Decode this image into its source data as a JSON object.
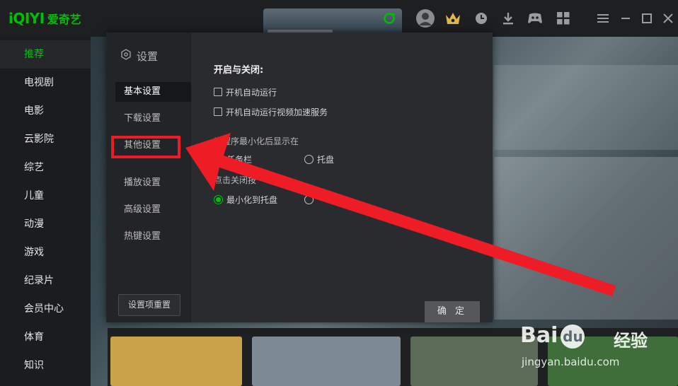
{
  "app": {
    "logo_mark": "iQIYI",
    "logo_cn": "爱奇艺"
  },
  "topbar": {
    "icons": [
      "vip-crown-icon",
      "history-icon",
      "download-icon",
      "game-controller-icon",
      "apps-grid-icon",
      "menu-icon",
      "minimize-icon",
      "maximize-icon",
      "close-icon"
    ],
    "accent": "#00be06"
  },
  "nav": {
    "items": [
      {
        "label": "推荐"
      },
      {
        "label": "电视剧"
      },
      {
        "label": "电影"
      },
      {
        "label": "云影院"
      },
      {
        "label": "综艺"
      },
      {
        "label": "儿童"
      },
      {
        "label": "动漫"
      },
      {
        "label": "游戏"
      },
      {
        "label": "纪录片"
      },
      {
        "label": "会员中心"
      },
      {
        "label": "体育"
      },
      {
        "label": "知识"
      }
    ],
    "active_index": 0
  },
  "settings": {
    "title": "设置",
    "side": [
      {
        "label": "基本设置"
      },
      {
        "label": "下载设置"
      },
      {
        "label": "其他设置"
      },
      {
        "label": "播放设置"
      },
      {
        "label": "高级设置"
      },
      {
        "label": "热键设置"
      }
    ],
    "active_index": 0,
    "reset_label": "设置项重置",
    "section_title": "开启与关闭:",
    "checkboxes": [
      {
        "label": "开机自动运行",
        "checked": false
      },
      {
        "label": "开机自动运行视频加速服务",
        "checked": false
      }
    ],
    "minimize_group": {
      "label": "当程序最小化后显示在",
      "options": [
        {
          "label": "任务栏",
          "selected": true
        },
        {
          "label": "托盘",
          "selected": false
        }
      ]
    },
    "close_group": {
      "label": "点击关闭按",
      "options": [
        {
          "label": "最小化到托盘",
          "selected": true
        },
        {
          "label": "",
          "selected": false
        }
      ]
    },
    "ok_label": "确 定"
  },
  "annotation": {
    "color": "#ee1c24",
    "target": "其他设置"
  },
  "watermark": {
    "brand": "Bai",
    "paw": "du",
    "cn": "经验",
    "url": "jingyan.baidu.com"
  }
}
